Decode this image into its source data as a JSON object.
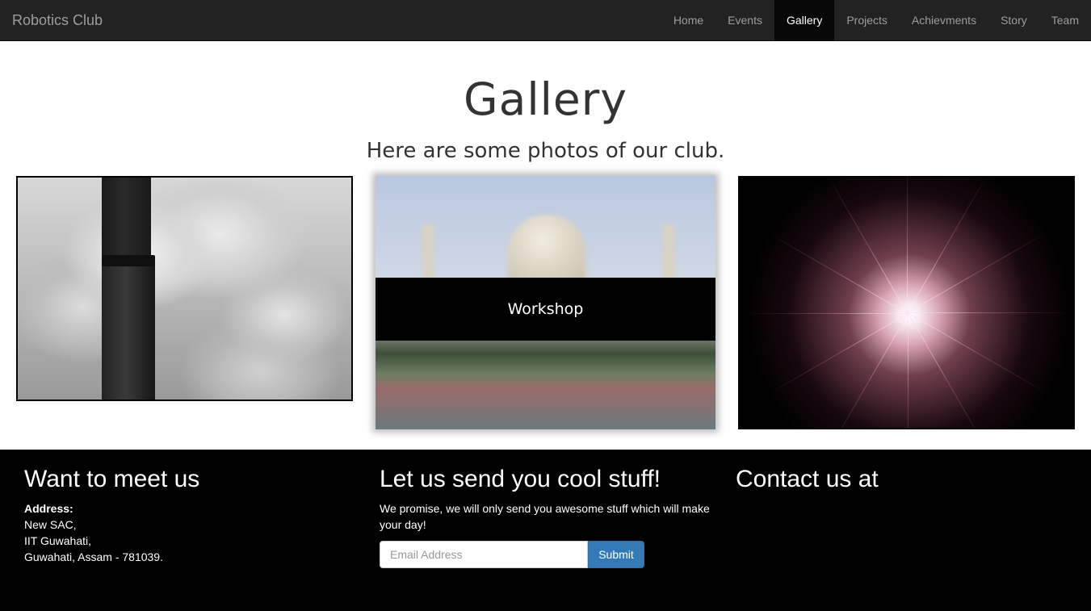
{
  "navbar": {
    "brand": "Robotics Club",
    "items": [
      {
        "label": "Home",
        "active": false
      },
      {
        "label": "Events",
        "active": false
      },
      {
        "label": "Gallery",
        "active": true
      },
      {
        "label": "Projects",
        "active": false
      },
      {
        "label": "Achievments",
        "active": false
      },
      {
        "label": "Story",
        "active": false
      },
      {
        "label": "Team",
        "active": false
      }
    ]
  },
  "gallery": {
    "title": "Gallery",
    "subtitle": "Here are some photos of our club.",
    "photos": [
      {
        "subject": "smokestack-with-smoke"
      },
      {
        "subject": "taj-mahal",
        "overlay_label": "Workshop"
      },
      {
        "subject": "fireworks"
      }
    ]
  },
  "footer": {
    "meet": {
      "heading": "Want to meet us",
      "address_label": "Address:",
      "address_lines": [
        "New SAC,",
        "IIT Guwahati,",
        "Guwahati, Assam - 781039."
      ]
    },
    "newsletter": {
      "heading": "Let us send you cool stuff!",
      "text": "We promise, we will only send you awesome stuff which will make your day!",
      "email_placeholder": "Email Address",
      "email_value": "",
      "submit_label": "Submit"
    },
    "contact": {
      "heading": "Contact us at"
    }
  },
  "colors": {
    "navbar_bg": "#222222",
    "nav_active_bg": "#080808",
    "footer_bg": "#000000",
    "submit_bg": "#337ab7"
  }
}
